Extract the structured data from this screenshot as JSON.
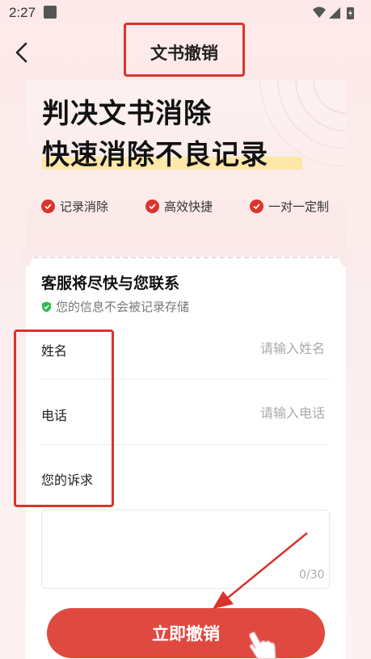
{
  "status_bar": {
    "time": "2:27"
  },
  "header": {
    "title": "文书撤销"
  },
  "hero": {
    "line1": "判决文书消除",
    "line2": "快速消除不良记录",
    "features": [
      "记录消除",
      "高效快捷",
      "一对一定制"
    ]
  },
  "form": {
    "heading": "客服将尽快与您联系",
    "privacy_note": "您的信息不会被记录存储",
    "name_label": "姓名",
    "name_placeholder": "请输入姓名",
    "phone_label": "电话",
    "phone_placeholder": "请输入电话",
    "request_label": "您的诉求",
    "request_counter": "0/30",
    "submit_label": "立即撤销"
  },
  "colors": {
    "accent": "#d9342b",
    "button": "#e04940",
    "highlight": "#fde8a8",
    "check_green": "#2db84d"
  },
  "icons": [
    "back-arrow-icon",
    "wifi-icon",
    "signal-icon",
    "battery-icon",
    "check-circle-icon",
    "shield-check-icon",
    "pointing-hand-icon"
  ]
}
